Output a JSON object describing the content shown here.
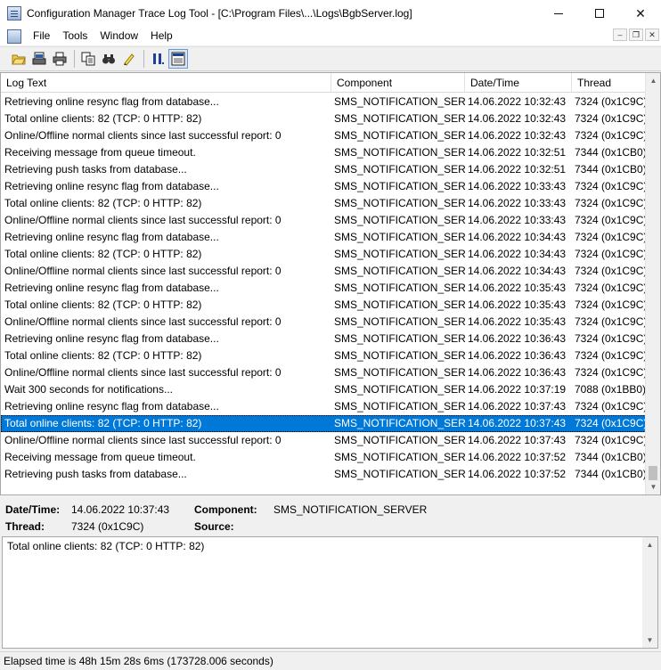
{
  "window": {
    "title": "Configuration Manager Trace Log Tool - [C:\\Program Files\\...\\Logs\\BgbServer.log]",
    "minimize_label": "—",
    "maximize_label": "☐",
    "close_label": "✕"
  },
  "menu": {
    "items": [
      "File",
      "Tools",
      "Window",
      "Help"
    ],
    "mdi_minimize": "–",
    "mdi_restore": "❐",
    "mdi_close": "✕"
  },
  "toolbar": {
    "icons": [
      "open-folder-icon",
      "print-preview-icon",
      "print-icon",
      "copy-icon",
      "find-icon",
      "highlight-icon",
      "pause-icon",
      "details-pane-icon"
    ]
  },
  "log": {
    "columns": [
      "Log Text",
      "Component",
      "Date/Time",
      "Thread"
    ],
    "rows": [
      {
        "text": "Retrieving online resync flag from database...",
        "component": "SMS_NOTIFICATION_SERVE",
        "datetime": "14.06.2022 10:32:43",
        "thread": "7324 (0x1C9C)"
      },
      {
        "text": "Total online clients: 82 (TCP: 0 HTTP: 82)",
        "component": "SMS_NOTIFICATION_SERVE",
        "datetime": "14.06.2022 10:32:43",
        "thread": "7324 (0x1C9C)"
      },
      {
        "text": "Online/Offline normal clients since last successful report: 0",
        "component": "SMS_NOTIFICATION_SERVE",
        "datetime": "14.06.2022 10:32:43",
        "thread": "7324 (0x1C9C)"
      },
      {
        "text": "Receiving message from queue timeout.",
        "component": "SMS_NOTIFICATION_SERVE",
        "datetime": "14.06.2022 10:32:51",
        "thread": "7344 (0x1CB0)"
      },
      {
        "text": "Retrieving push tasks from database...",
        "component": "SMS_NOTIFICATION_SERVE",
        "datetime": "14.06.2022 10:32:51",
        "thread": "7344 (0x1CB0)"
      },
      {
        "text": "Retrieving online resync flag from database...",
        "component": "SMS_NOTIFICATION_SERVE",
        "datetime": "14.06.2022 10:33:43",
        "thread": "7324 (0x1C9C)"
      },
      {
        "text": "Total online clients: 82 (TCP: 0 HTTP: 82)",
        "component": "SMS_NOTIFICATION_SERVE",
        "datetime": "14.06.2022 10:33:43",
        "thread": "7324 (0x1C9C)"
      },
      {
        "text": "Online/Offline normal clients since last successful report: 0",
        "component": "SMS_NOTIFICATION_SERVE",
        "datetime": "14.06.2022 10:33:43",
        "thread": "7324 (0x1C9C)"
      },
      {
        "text": "Retrieving online resync flag from database...",
        "component": "SMS_NOTIFICATION_SERVE",
        "datetime": "14.06.2022 10:34:43",
        "thread": "7324 (0x1C9C)"
      },
      {
        "text": "Total online clients: 82 (TCP: 0 HTTP: 82)",
        "component": "SMS_NOTIFICATION_SERVE",
        "datetime": "14.06.2022 10:34:43",
        "thread": "7324 (0x1C9C)"
      },
      {
        "text": "Online/Offline normal clients since last successful report: 0",
        "component": "SMS_NOTIFICATION_SERVE",
        "datetime": "14.06.2022 10:34:43",
        "thread": "7324 (0x1C9C)"
      },
      {
        "text": "Retrieving online resync flag from database...",
        "component": "SMS_NOTIFICATION_SERVE",
        "datetime": "14.06.2022 10:35:43",
        "thread": "7324 (0x1C9C)"
      },
      {
        "text": "Total online clients: 82 (TCP: 0 HTTP: 82)",
        "component": "SMS_NOTIFICATION_SERVE",
        "datetime": "14.06.2022 10:35:43",
        "thread": "7324 (0x1C9C)"
      },
      {
        "text": "Online/Offline normal clients since last successful report: 0",
        "component": "SMS_NOTIFICATION_SERVE",
        "datetime": "14.06.2022 10:35:43",
        "thread": "7324 (0x1C9C)"
      },
      {
        "text": "Retrieving online resync flag from database...",
        "component": "SMS_NOTIFICATION_SERVE",
        "datetime": "14.06.2022 10:36:43",
        "thread": "7324 (0x1C9C)"
      },
      {
        "text": "Total online clients: 82 (TCP: 0 HTTP: 82)",
        "component": "SMS_NOTIFICATION_SERVE",
        "datetime": "14.06.2022 10:36:43",
        "thread": "7324 (0x1C9C)"
      },
      {
        "text": "Online/Offline normal clients since last successful report: 0",
        "component": "SMS_NOTIFICATION_SERVE",
        "datetime": "14.06.2022 10:36:43",
        "thread": "7324 (0x1C9C)"
      },
      {
        "text": "Wait 300 seconds for notifications...",
        "component": "SMS_NOTIFICATION_SERVE",
        "datetime": "14.06.2022 10:37:19",
        "thread": "7088 (0x1BB0)"
      },
      {
        "text": "Retrieving online resync flag from database...",
        "component": "SMS_NOTIFICATION_SERVE",
        "datetime": "14.06.2022 10:37:43",
        "thread": "7324 (0x1C9C)"
      },
      {
        "text": "Total online clients: 82 (TCP: 0 HTTP: 82)",
        "component": "SMS_NOTIFICATION_SERVE",
        "datetime": "14.06.2022 10:37:43",
        "thread": "7324 (0x1C9C)",
        "selected": true
      },
      {
        "text": "Online/Offline normal clients since last successful report: 0",
        "component": "SMS_NOTIFICATION_SERVE",
        "datetime": "14.06.2022 10:37:43",
        "thread": "7324 (0x1C9C)"
      },
      {
        "text": "Receiving message from queue timeout.",
        "component": "SMS_NOTIFICATION_SERVE",
        "datetime": "14.06.2022 10:37:52",
        "thread": "7344 (0x1CB0)"
      },
      {
        "text": "Retrieving push tasks from database...",
        "component": "SMS_NOTIFICATION_SERVE",
        "datetime": "14.06.2022 10:37:52",
        "thread": "7344 (0x1CB0)"
      }
    ]
  },
  "details": {
    "datetime_label": "Date/Time:",
    "datetime_value": "14.06.2022 10:37:43",
    "component_label": "Component:",
    "component_value": "SMS_NOTIFICATION_SERVER",
    "thread_label": "Thread:",
    "thread_value": "7324 (0x1C9C)",
    "source_label": "Source:",
    "source_value": "",
    "message": "Total online clients: 82 (TCP: 0 HTTP: 82)"
  },
  "status": {
    "text": "Elapsed time is 48h 15m 28s 6ms (173728.006 seconds)"
  },
  "colors": {
    "selection": "#0078d7"
  }
}
